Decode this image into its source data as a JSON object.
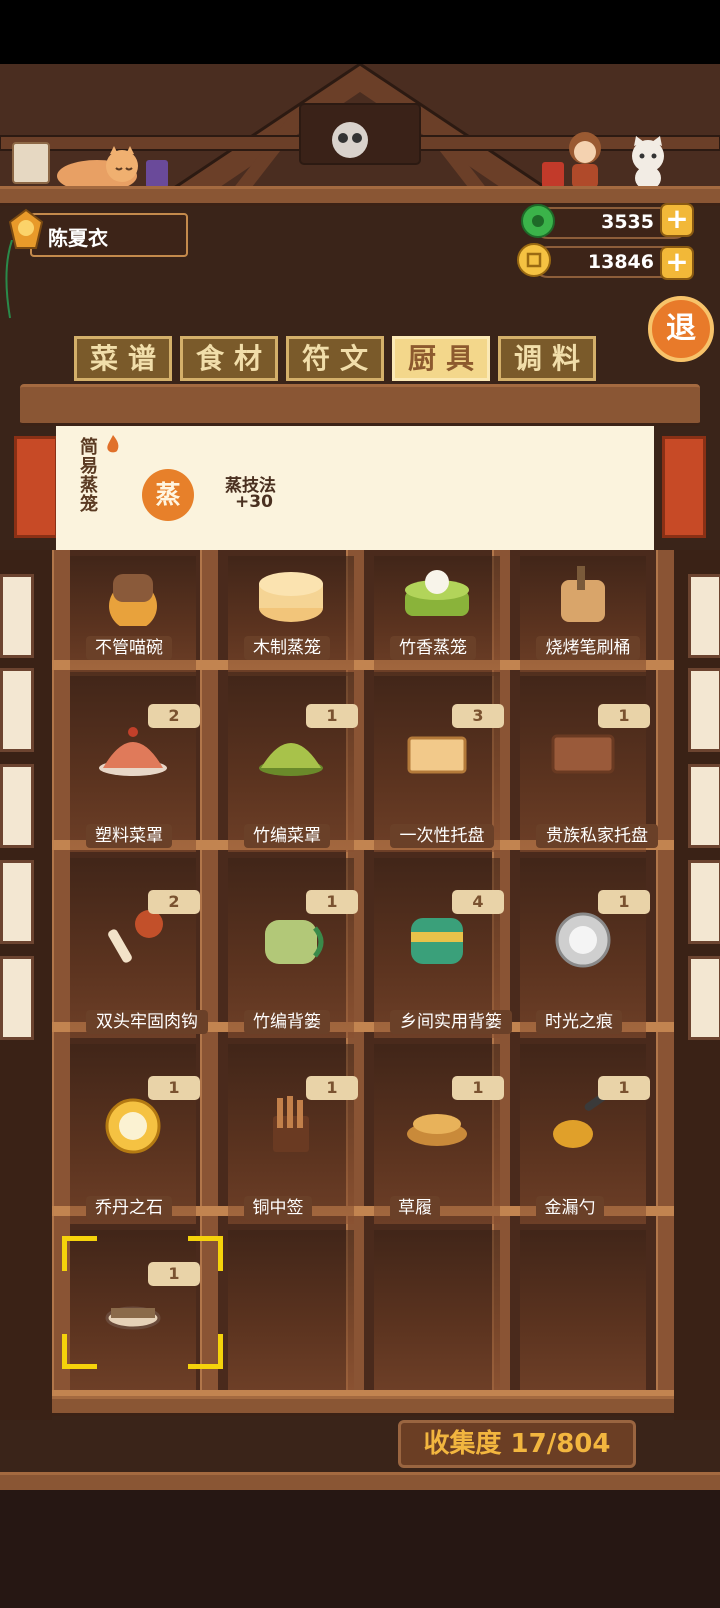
{
  "player": {
    "name": "陈夏衣"
  },
  "currency": {
    "jade": "3535",
    "gold": "13846"
  },
  "exit": {
    "label": "退"
  },
  "tabs": [
    {
      "label": "菜谱",
      "active": false
    },
    {
      "label": "食材",
      "active": false
    },
    {
      "label": "符文",
      "active": false
    },
    {
      "label": "厨具",
      "active": true
    },
    {
      "label": "调料",
      "active": false
    }
  ],
  "selected_item": {
    "name": "简易蒸笼",
    "skill_icon": "蒸",
    "skill_name": "蒸技法",
    "skill_bonus": "+30"
  },
  "items": [
    {
      "name": "不管喵碗",
      "count": ""
    },
    {
      "name": "木制蒸笼",
      "count": ""
    },
    {
      "name": "竹香蒸笼",
      "count": ""
    },
    {
      "name": "烧烤笔刷桶",
      "count": ""
    },
    {
      "name": "塑料菜罩",
      "count": "2"
    },
    {
      "name": "竹编菜罩",
      "count": "1"
    },
    {
      "name": "一次性托盘",
      "count": "3"
    },
    {
      "name": "贵族私家托盘",
      "count": "1"
    },
    {
      "name": "双头牢固肉钩",
      "count": "2"
    },
    {
      "name": "竹编背篓",
      "count": "1"
    },
    {
      "name": "乡间实用背篓",
      "count": "4"
    },
    {
      "name": "时光之痕",
      "count": "1"
    },
    {
      "name": "乔丹之石",
      "count": "1"
    },
    {
      "name": "铜中签",
      "count": "1"
    },
    {
      "name": "草履",
      "count": "1"
    },
    {
      "name": "金漏勺",
      "count": "1"
    },
    {
      "name": "",
      "count": "1"
    }
  ],
  "collection": {
    "label": "收集度 17/804"
  },
  "colors": {
    "accent": "#f2b838",
    "highlight": "#f5d30b",
    "wood": "#8a5634"
  }
}
